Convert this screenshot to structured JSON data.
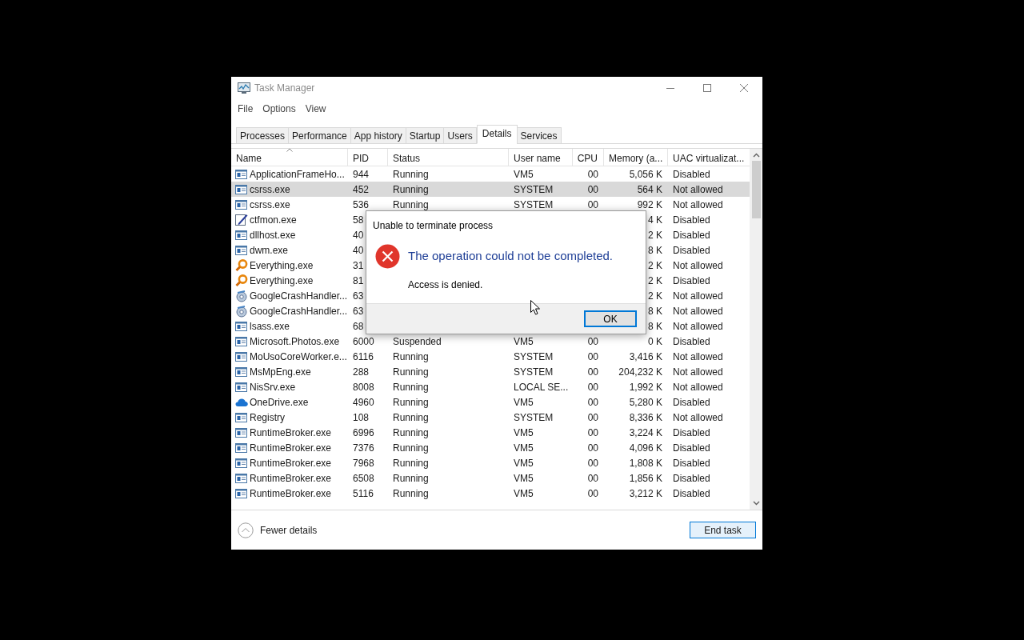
{
  "window": {
    "title": "Task Manager"
  },
  "menu": [
    "File",
    "Options",
    "View"
  ],
  "tabs": [
    {
      "label": "Processes",
      "selected": false
    },
    {
      "label": "Performance",
      "selected": false
    },
    {
      "label": "App history",
      "selected": false
    },
    {
      "label": "Startup",
      "selected": false
    },
    {
      "label": "Users",
      "selected": false
    },
    {
      "label": "Details",
      "selected": true
    },
    {
      "label": "Services",
      "selected": false
    }
  ],
  "table": {
    "columns": [
      "Name",
      "PID",
      "Status",
      "User name",
      "CPU",
      "Memory (a...",
      "UAC virtualizat..."
    ],
    "rows": [
      {
        "kind": "app",
        "name": "ApplicationFrameHo...",
        "pid": "944",
        "status": "Running",
        "user": "VM5",
        "cpu": "00",
        "memory": "5,056 K",
        "uac": "Disabled",
        "selected": false
      },
      {
        "kind": "app",
        "name": "csrss.exe",
        "pid": "452",
        "status": "Running",
        "user": "SYSTEM",
        "cpu": "00",
        "memory": "564 K",
        "uac": "Not allowed",
        "selected": true
      },
      {
        "kind": "app",
        "name": "csrss.exe",
        "pid": "536",
        "status": "Running",
        "user": "SYSTEM",
        "cpu": "00",
        "memory": "992 K",
        "uac": "Not allowed",
        "selected": false
      },
      {
        "kind": "pen",
        "name": "ctfmon.exe",
        "pid": "58",
        "memory": "4 K",
        "uac": "Disabled",
        "selected": false
      },
      {
        "kind": "app",
        "name": "dllhost.exe",
        "pid": "40",
        "memory": "2 K",
        "uac": "Disabled",
        "selected": false
      },
      {
        "kind": "app",
        "name": "dwm.exe",
        "pid": "40",
        "memory": "8 K",
        "uac": "Disabled",
        "selected": false
      },
      {
        "kind": "magnifier",
        "name": "Everything.exe",
        "pid": "31",
        "memory": "2 K",
        "uac": "Not allowed",
        "selected": false
      },
      {
        "kind": "magnifier",
        "name": "Everything.exe",
        "pid": "81",
        "memory": "2 K",
        "uac": "Disabled",
        "selected": false
      },
      {
        "kind": "gear",
        "name": "GoogleCrashHandler...",
        "pid": "63",
        "memory": "2 K",
        "uac": "Not allowed",
        "selected": false
      },
      {
        "kind": "gear",
        "name": "GoogleCrashHandler...",
        "pid": "63",
        "memory": "8 K",
        "uac": "Not allowed",
        "selected": false
      },
      {
        "kind": "app",
        "name": "lsass.exe",
        "pid": "68",
        "memory": "8 K",
        "uac": "Not allowed",
        "selected": false
      },
      {
        "kind": "app",
        "name": "Microsoft.Photos.exe",
        "pid": "6000",
        "status": "Suspended",
        "user": "VM5",
        "cpu": "00",
        "memory": "0 K",
        "uac": "Disabled",
        "selected": false
      },
      {
        "kind": "app",
        "name": "MoUsoCoreWorker.e...",
        "pid": "6116",
        "status": "Running",
        "user": "SYSTEM",
        "cpu": "00",
        "memory": "3,416 K",
        "uac": "Not allowed",
        "selected": false
      },
      {
        "kind": "app",
        "name": "MsMpEng.exe",
        "pid": "288",
        "status": "Running",
        "user": "SYSTEM",
        "cpu": "00",
        "memory": "204,232 K",
        "uac": "Not allowed",
        "selected": false
      },
      {
        "kind": "app",
        "name": "NisSrv.exe",
        "pid": "8008",
        "status": "Running",
        "user": "LOCAL SE...",
        "cpu": "00",
        "memory": "1,992 K",
        "uac": "Not allowed",
        "selected": false
      },
      {
        "kind": "cloud",
        "name": "OneDrive.exe",
        "pid": "4960",
        "status": "Running",
        "user": "VM5",
        "cpu": "00",
        "memory": "5,280 K",
        "uac": "Disabled",
        "selected": false
      },
      {
        "kind": "app",
        "name": "Registry",
        "pid": "108",
        "status": "Running",
        "user": "SYSTEM",
        "cpu": "00",
        "memory": "8,336 K",
        "uac": "Not allowed",
        "selected": false
      },
      {
        "kind": "app",
        "name": "RuntimeBroker.exe",
        "pid": "6996",
        "status": "Running",
        "user": "VM5",
        "cpu": "00",
        "memory": "3,224 K",
        "uac": "Disabled",
        "selected": false
      },
      {
        "kind": "app",
        "name": "RuntimeBroker.exe",
        "pid": "7376",
        "status": "Running",
        "user": "VM5",
        "cpu": "00",
        "memory": "4,096 K",
        "uac": "Disabled",
        "selected": false
      },
      {
        "kind": "app",
        "name": "RuntimeBroker.exe",
        "pid": "7968",
        "status": "Running",
        "user": "VM5",
        "cpu": "00",
        "memory": "1,808 K",
        "uac": "Disabled",
        "selected": false
      },
      {
        "kind": "app",
        "name": "RuntimeBroker.exe",
        "pid": "6508",
        "status": "Running",
        "user": "VM5",
        "cpu": "00",
        "memory": "1,856 K",
        "uac": "Disabled",
        "selected": false
      },
      {
        "kind": "app",
        "name": "RuntimeBroker.exe",
        "pid": "5116",
        "status": "Running",
        "user": "VM5",
        "cpu": "00",
        "memory": "3,212 K",
        "uac": "Disabled",
        "selected": false
      }
    ]
  },
  "footer": {
    "fewer_details": "Fewer details",
    "end_task": "End task"
  },
  "dialog": {
    "title": "Unable to terminate process",
    "heading": "The operation could not be completed.",
    "message": "Access is denied.",
    "button": "OK"
  }
}
